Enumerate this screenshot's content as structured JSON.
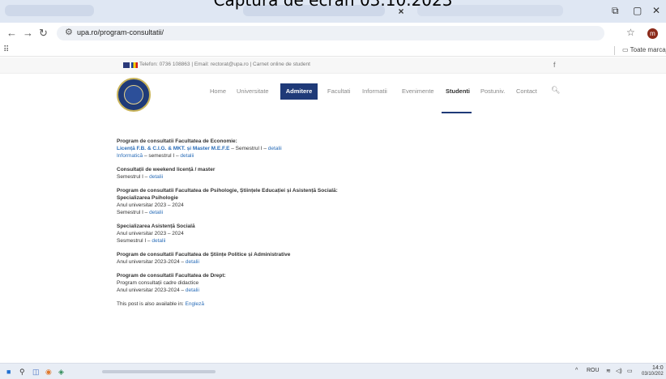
{
  "caption": "Captura de ecran 03.10.2023",
  "browser": {
    "tab_close": "×",
    "url": "upa.ro/program-consultatii/",
    "bookmark_folder": "Toate marcajele",
    "profile_initial": "m"
  },
  "site": {
    "topbar_text": "Telefon: 0736 108863 | Email: rectorat@upa.ro | Carnet online de student",
    "facebook": "f",
    "menu": [
      "Home",
      "Universitate",
      "Admitere",
      "Facultati",
      "Informatii",
      "Evenimente",
      "Studenti",
      "Postuniv.",
      "Contact"
    ]
  },
  "content": {
    "b1_title": "Program de consultatii Facultatea de Economie:",
    "b1_l1_link": "Licență F.B. & C.I.G. & MKT. și Master M.E.F.E",
    "b1_l1_text": " – Semestrul I – ",
    "b1_l1_detail": "detalii",
    "b1_l2_link": "Informatică",
    "b1_l2_text": " – semestrul I – ",
    "b1_l2_detail": "detalii",
    "b2_title": "Consultații de weekend licență / master",
    "b2_l1_text": "Semestrul I – ",
    "b2_l1_detail": "detalii",
    "b3_title": "Program de consultatii Facultatea de Psihologie, Științele Educației și Asistență Socială:",
    "b3_sub": "Specializarea Psihologie",
    "b3_l1": "Anul universitar 2023 – 2024",
    "b3_l2_text": "Semestrul  I – ",
    "b3_l2_detail": "detalii",
    "b4_title": "Specializarea Asistență Socială",
    "b4_l1": "Anul universitar 2023 – 2024",
    "b4_l2_text": "Sesmestrul I – ",
    "b4_l2_detail": "detalii",
    "b5_title": "Program de consultatii Facultatea de Științe Politice și Administrative",
    "b5_l1_text": "Anul universitar 2023-2024 – ",
    "b5_l1_detail": "detalii",
    "b6_title": "Program de consultatii Facultatea de Drept:",
    "b6_l1": "Program consultații cadre didactice",
    "b6_l2_text": "Anul universitar 2023-2024 – ",
    "b6_l2_detail": "detalii",
    "footer_text": "This post is also available in: ",
    "footer_link": "Engleză"
  },
  "taskbar": {
    "lang": "ROU",
    "time": "14:0",
    "date": "03/10/202"
  }
}
